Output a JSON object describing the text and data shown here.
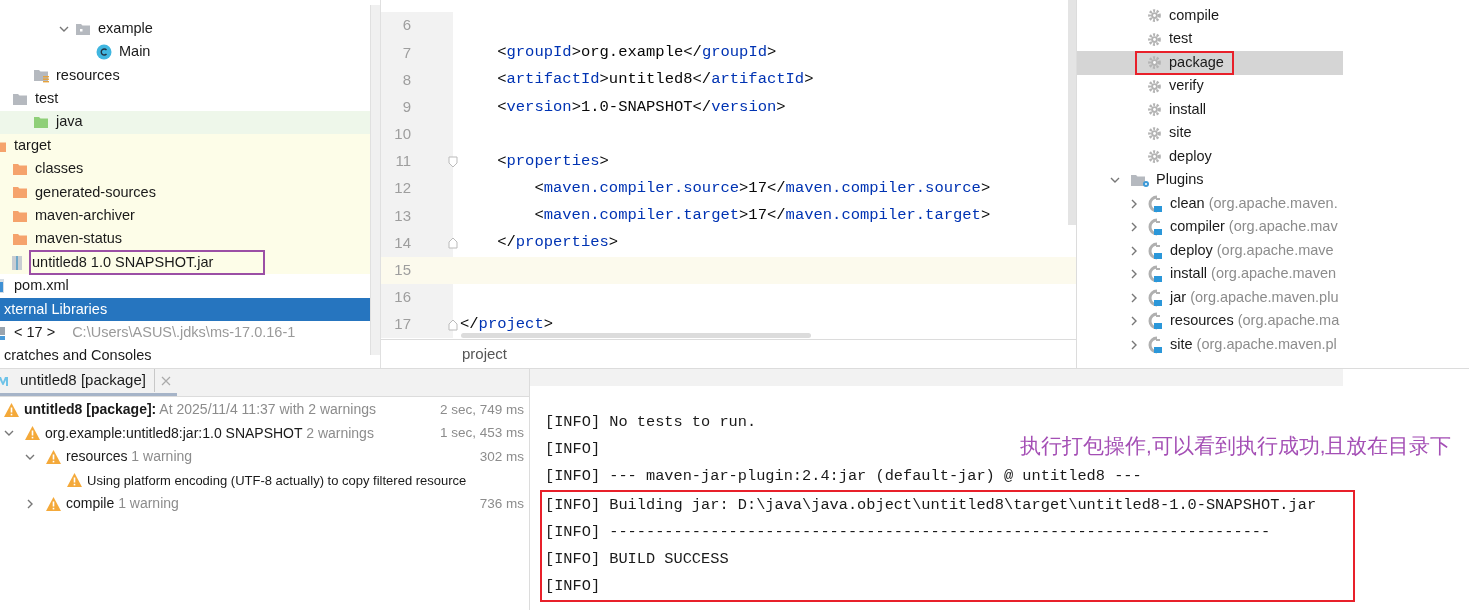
{
  "project_tree": {
    "items": [
      {
        "label": "example",
        "kind": "package",
        "expanded": true,
        "selected": false,
        "marked": false,
        "children": [
          {
            "label": "Main",
            "kind": "class",
            "selected": false,
            "marked": false
          }
        ]
      },
      {
        "label": "resources",
        "kind": "resources",
        "selected": false,
        "marked": false
      },
      {
        "label": "test",
        "kind": "folder",
        "selected": false,
        "marked": false,
        "children": [
          {
            "label": "java",
            "kind": "test-sources",
            "selected": false,
            "marked": false
          }
        ]
      },
      {
        "label": "target",
        "kind": "excluded",
        "selected": false,
        "marked": false,
        "children": [
          {
            "label": "classes",
            "kind": "excluded",
            "selected": false,
            "marked": false
          },
          {
            "label": "generated-sources",
            "kind": "excluded",
            "selected": false,
            "marked": false
          },
          {
            "label": "maven-archiver",
            "kind": "excluded",
            "selected": false,
            "marked": false
          },
          {
            "label": "maven-status",
            "kind": "excluded",
            "selected": false,
            "marked": false
          },
          {
            "label": "untitled8 1.0 SNAPSHOT.jar",
            "kind": "jar",
            "selected": false,
            "marked": true
          }
        ]
      },
      {
        "label": "pom.xml",
        "kind": "pom",
        "selected": false,
        "marked": false
      },
      {
        "label": "xternal Libraries",
        "kind": "plain",
        "selected": true,
        "marked": false
      },
      {
        "label": "< 17 >",
        "detail": "C:\\Users\\ASUS\\.jdks\\ms-17.0.16-1",
        "kind": "sdk",
        "selected": false,
        "marked": false
      },
      {
        "label": "cratches and Consoles",
        "kind": "plain",
        "selected": false,
        "marked": false
      }
    ]
  },
  "editor": {
    "lines": [
      {
        "number": "6",
        "current": false,
        "fold_start": false,
        "fold_end": false
      },
      {
        "number": "7",
        "current": false,
        "fold_start": false,
        "fold_end": false,
        "segments": [
          {
            "text": "    <",
            "kind": "plain"
          },
          {
            "text": "groupId",
            "kind": "tag"
          },
          {
            "text": ">org.example</",
            "kind": "plain"
          },
          {
            "text": "groupId",
            "kind": "tag"
          },
          {
            "text": ">",
            "kind": "plain"
          }
        ]
      },
      {
        "number": "8",
        "current": false,
        "fold_start": false,
        "fold_end": false,
        "segments": [
          {
            "text": "    <",
            "kind": "plain"
          },
          {
            "text": "artifactId",
            "kind": "tag"
          },
          {
            "text": ">untitled8</",
            "kind": "plain"
          },
          {
            "text": "artifactId",
            "kind": "tag"
          },
          {
            "text": ">",
            "kind": "plain"
          }
        ]
      },
      {
        "number": "9",
        "current": false,
        "fold_start": false,
        "fold_end": false,
        "segments": [
          {
            "text": "    <",
            "kind": "plain"
          },
          {
            "text": "version",
            "kind": "tag"
          },
          {
            "text": ">1.0-SNAPSHOT</",
            "kind": "plain"
          },
          {
            "text": "version",
            "kind": "tag"
          },
          {
            "text": ">",
            "kind": "plain"
          }
        ]
      },
      {
        "number": "10",
        "current": false,
        "fold_start": false,
        "fold_end": false
      },
      {
        "number": "11",
        "current": false,
        "fold_start": true,
        "fold_end": false,
        "segments": [
          {
            "text": "    <",
            "kind": "plain"
          },
          {
            "text": "properties",
            "kind": "tag"
          },
          {
            "text": ">",
            "kind": "plain"
          }
        ]
      },
      {
        "number": "12",
        "current": false,
        "fold_start": false,
        "fold_end": false,
        "segments": [
          {
            "text": "        <",
            "kind": "plain"
          },
          {
            "text": "maven.compiler.source",
            "kind": "tag"
          },
          {
            "text": ">17</",
            "kind": "plain"
          },
          {
            "text": "maven.compiler.source",
            "kind": "tag"
          },
          {
            "text": ">",
            "kind": "plain"
          }
        ]
      },
      {
        "number": "13",
        "current": false,
        "fold_start": false,
        "fold_end": false,
        "segments": [
          {
            "text": "        <",
            "kind": "plain"
          },
          {
            "text": "maven.compiler.target",
            "kind": "tag"
          },
          {
            "text": ">17</",
            "kind": "plain"
          },
          {
            "text": "maven.compiler.target",
            "kind": "tag"
          },
          {
            "text": ">",
            "kind": "plain"
          }
        ]
      },
      {
        "number": "14",
        "current": false,
        "fold_start": false,
        "fold_end": true,
        "segments": [
          {
            "text": "    </",
            "kind": "plain"
          },
          {
            "text": "properties",
            "kind": "tag"
          },
          {
            "text": ">",
            "kind": "plain"
          }
        ]
      },
      {
        "number": "15",
        "current": true,
        "fold_start": false,
        "fold_end": false
      },
      {
        "number": "16",
        "current": false,
        "fold_start": false,
        "fold_end": false
      },
      {
        "number": "17",
        "current": false,
        "fold_start": false,
        "fold_end": true,
        "segments": [
          {
            "text": "</",
            "kind": "plain"
          },
          {
            "text": "project",
            "kind": "tag"
          },
          {
            "text": ">",
            "kind": "plain"
          }
        ]
      }
    ],
    "breadcrumb": "project"
  },
  "maven": {
    "lifecycle": [
      {
        "label": "compile",
        "selected": false,
        "marked": false
      },
      {
        "label": "test",
        "selected": false,
        "marked": false
      },
      {
        "label": "package",
        "selected": true,
        "marked": true
      },
      {
        "label": "verify",
        "selected": false,
        "marked": false
      },
      {
        "label": "install",
        "selected": false,
        "marked": false
      },
      {
        "label": "site",
        "selected": false,
        "marked": false
      },
      {
        "label": "deploy",
        "selected": false,
        "marked": false
      }
    ],
    "plugins": {
      "label": "Plugins",
      "expanded": true,
      "selected": false,
      "children": [
        {
          "name": "clean",
          "detail": "(org.apache.maven.",
          "expanded": false,
          "selected": false
        },
        {
          "name": "compiler",
          "detail": "(org.apache.mav",
          "expanded": false,
          "selected": false
        },
        {
          "name": "deploy",
          "detail": "(org.apache.mave",
          "expanded": false,
          "selected": false
        },
        {
          "name": "install",
          "detail": "(org.apache.maven",
          "expanded": false,
          "selected": false
        },
        {
          "name": "jar",
          "detail": "(org.apache.maven.plu",
          "expanded": false,
          "selected": false
        },
        {
          "name": "resources",
          "detail": "(org.apache.ma",
          "expanded": false,
          "selected": false
        },
        {
          "name": "site",
          "detail": "(org.apache.maven.pl",
          "expanded": false,
          "selected": false
        }
      ]
    }
  },
  "build": {
    "tab": {
      "label": "untitled8 [package]",
      "selected": true
    },
    "items": [
      {
        "title": "untitled8 [package]:",
        "detail": "At 2025/11/4 11:37 with 2 warnings",
        "time": "2 sec, 749 ms",
        "warning": true,
        "children": [
          {
            "title": "org.example:untitled8:jar:1.0 SNAPSHOT",
            "detail": "2 warnings",
            "time": "1 sec, 453 ms",
            "warning": true,
            "expanded": true,
            "children": [
              {
                "title": "resources",
                "detail": "1 warning",
                "time": "302 ms",
                "warning": true,
                "expanded": true,
                "children": [
                  {
                    "title": "Using platform encoding (UTF-8 actually) to copy filtered resource",
                    "warning": true
                  }
                ]
              },
              {
                "title": "compile",
                "detail": "1 warning",
                "time": "736 ms",
                "warning": true,
                "expanded": false
              }
            ]
          }
        ]
      }
    ]
  },
  "console": {
    "lines": [
      {
        "text": "[INFO] No tests to run.",
        "boxed": false
      },
      {
        "text": "[INFO]",
        "boxed": false
      },
      {
        "text": "[INFO] --- maven-jar-plugin:2.4:jar (default-jar) @ untitled8 ---",
        "boxed": false
      },
      {
        "text": "[INFO] Building jar: D:\\java\\java.object\\untitled8\\target\\untitled8-1.0-SNAPSHOT.jar",
        "boxed": true
      },
      {
        "text": "[INFO] ------------------------------------------------------------------------",
        "boxed": true
      },
      {
        "text": "[INFO] BUILD SUCCESS",
        "boxed": true
      },
      {
        "text": "[INFO]",
        "boxed": true
      }
    ]
  },
  "annotation": {
    "text": "执行打包操作,可以看到执行成功,且放在目录下"
  }
}
